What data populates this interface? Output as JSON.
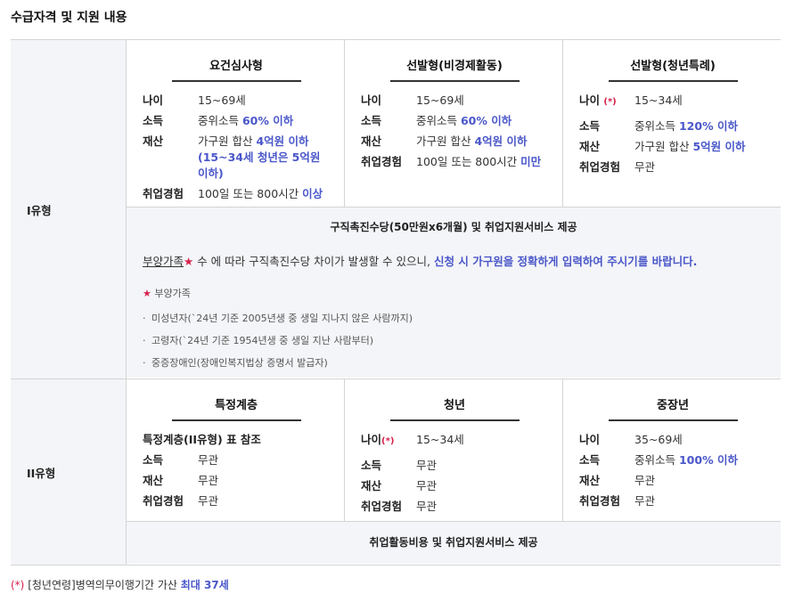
{
  "title": "수급자격 및 지원 내용",
  "type1": {
    "label": "I유형",
    "columns": [
      {
        "header": "요건심사형",
        "age_label": "나이",
        "age_value": "15~69세",
        "income_label": "소득",
        "income_prefix": "중위소득 ",
        "income_hl": "60% 이하",
        "asset_label": "재산",
        "asset_prefix": "가구원 합산 ",
        "asset_hl": "4억원 이하",
        "asset_extra": "(15~34세 청년은 5억원 이하)",
        "emp_label": "취업경험",
        "emp_prefix": "100일 또는 800시간 ",
        "emp_hl": "이상"
      },
      {
        "header": "선발형(비경제활동)",
        "age_label": "나이",
        "age_value": "15~69세",
        "income_label": "소득",
        "income_prefix": "중위소득 ",
        "income_hl": "60% 이하",
        "asset_label": "재산",
        "asset_prefix": "가구원 합산 ",
        "asset_hl": "4억원 이하",
        "emp_label": "취업경험",
        "emp_prefix": "100일 또는 800시간 ",
        "emp_hl": "미만"
      },
      {
        "header": "선발형(청년특례)",
        "age_label": "나이",
        "age_mark": "(*)",
        "age_value": "15~34세",
        "income_label": "소득",
        "income_prefix": "중위소득 ",
        "income_hl": "120% 이하",
        "asset_label": "재산",
        "asset_prefix": "가구원 합산 ",
        "asset_hl": "5억원 이하",
        "emp_label": "취업경험",
        "emp_value": "무관"
      }
    ],
    "benefit": "구직촉진수당(50만원x6개월) 및 취업지원서비스 제공",
    "notice_underline": "부양가족",
    "notice_star": "★",
    "notice_mid": " 수 에 따라 구직촉진수당 차이가 발생할 수 있으니, ",
    "notice_blue": "신청 시 가구원을 정확하게 입력하여 주시기를 바랍니다.",
    "legend_star": "★",
    "legend_label": " 부양가족",
    "bullets": [
      "미성년자(`24년 기준 2005년생 중 생일 지나지 않은 사람까지)",
      "고령자(`24년 기준 1954년생 중 생일 지난 사람부터)",
      "중증장애인(장애인복지법상 증명서 발급자)"
    ]
  },
  "type2": {
    "label": "II유형",
    "columns": [
      {
        "header": "특정계층",
        "note": "특정계층(II유형) 표 참조",
        "income_label": "소득",
        "income_value": "무관",
        "asset_label": "재산",
        "asset_value": "무관",
        "emp_label": "취업경험",
        "emp_value": "무관"
      },
      {
        "header": "청년",
        "age_label": "나이",
        "age_mark": "(*)",
        "age_value": "15~34세",
        "income_label": "소득",
        "income_value": "무관",
        "asset_label": "재산",
        "asset_value": "무관",
        "emp_label": "취업경험",
        "emp_value": "무관"
      },
      {
        "header": "중장년",
        "age_label": "나이",
        "age_value": "35~69세",
        "income_label": "소득",
        "income_prefix": "중위소득 ",
        "income_hl": "100% 이하",
        "asset_label": "재산",
        "asset_value": "무관",
        "emp_label": "취업경험",
        "emp_value": "무관"
      }
    ],
    "benefit": "취업활동비용 및 취업지원서비스 제공"
  },
  "footnote": {
    "mark": "(*)",
    "text": " [청년연령]병역의무이행기간 가산 ",
    "hl": "최대 37세"
  },
  "colors": {
    "accent_blue": "#4a57c9",
    "accent_red": "#d6204b",
    "cell_bg": "#f4f5f8"
  }
}
